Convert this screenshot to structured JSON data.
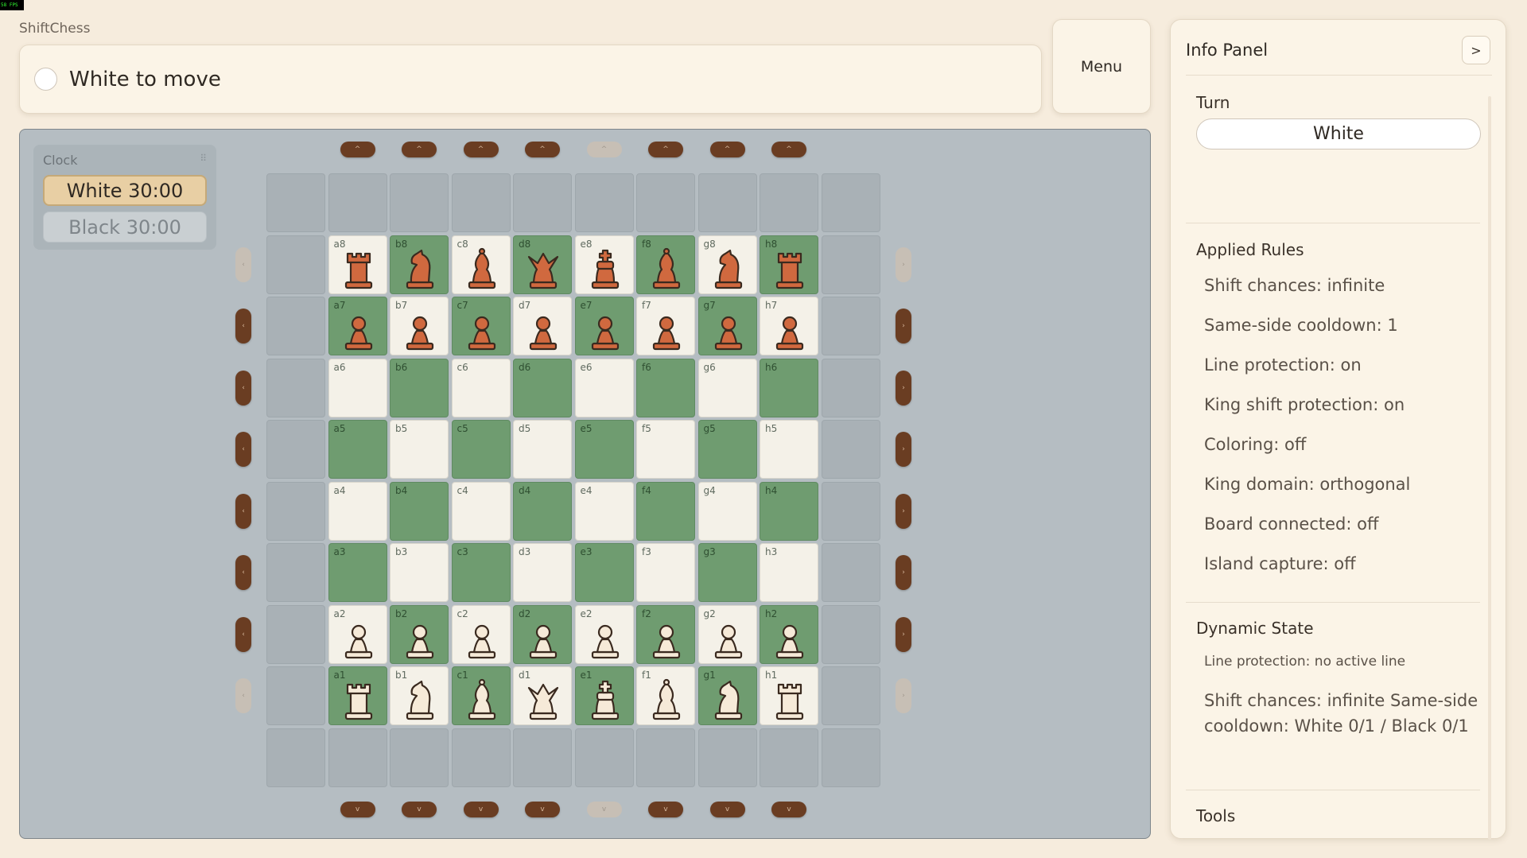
{
  "fps": "58 FPS",
  "app": {
    "title": "ShiftChess"
  },
  "status": {
    "text": "White to move"
  },
  "menu": {
    "label": "Menu"
  },
  "clock": {
    "title": "Clock",
    "grip": "⠿",
    "white": "White 30:00",
    "black": "Black 30:00"
  },
  "board": {
    "files": [
      "a",
      "b",
      "c",
      "d",
      "e",
      "f",
      "g",
      "h"
    ],
    "ranks": [
      8,
      7,
      6,
      5,
      4,
      3,
      2,
      1
    ],
    "white_color": "#f6ead8",
    "black_color": "#d0693f",
    "light_square": "#f4f1e8",
    "dark_square": "#6f9c70",
    "pieces": {
      "8": [
        "b-rook",
        "b-knight",
        "b-bishop",
        "b-queen",
        "b-king",
        "b-bishop",
        "b-knight",
        "b-rook"
      ],
      "7": [
        "b-pawn",
        "b-pawn",
        "b-pawn",
        "b-pawn",
        "b-pawn",
        "b-pawn",
        "b-pawn",
        "b-pawn"
      ],
      "2": [
        "w-pawn",
        "w-pawn",
        "w-pawn",
        "w-pawn",
        "w-pawn",
        "w-pawn",
        "w-pawn",
        "w-pawn"
      ],
      "1": [
        "w-rook",
        "w-knight",
        "w-bishop",
        "w-queen",
        "w-king",
        "w-bishop",
        "w-knight",
        "w-rook"
      ]
    },
    "shift_up_glyph": "^",
    "shift_down_glyph": "v",
    "shift_left_glyph": "‹",
    "shift_right_glyph": "›",
    "disabled_columns": [
      "e"
    ],
    "disabled_rows": [
      8,
      1
    ]
  },
  "info": {
    "title": "Info Panel",
    "toggle": ">",
    "turn_heading": "Turn",
    "turn_value": "White",
    "rules_heading": "Applied Rules",
    "rules": [
      "Shift chances: infinite",
      "Same-side cooldown: 1",
      "Line protection: on",
      "King shift protection: on",
      "Coloring: off",
      "King domain: orthogonal",
      "Board connected: off",
      "Island capture: off"
    ],
    "dynamic_heading": "Dynamic State",
    "dynamic_line": "Line protection: no active line",
    "dynamic_text": "Shift chances: infinite Same-side cooldown: White 0/1 / Black 0/1",
    "tools_heading": "Tools"
  }
}
